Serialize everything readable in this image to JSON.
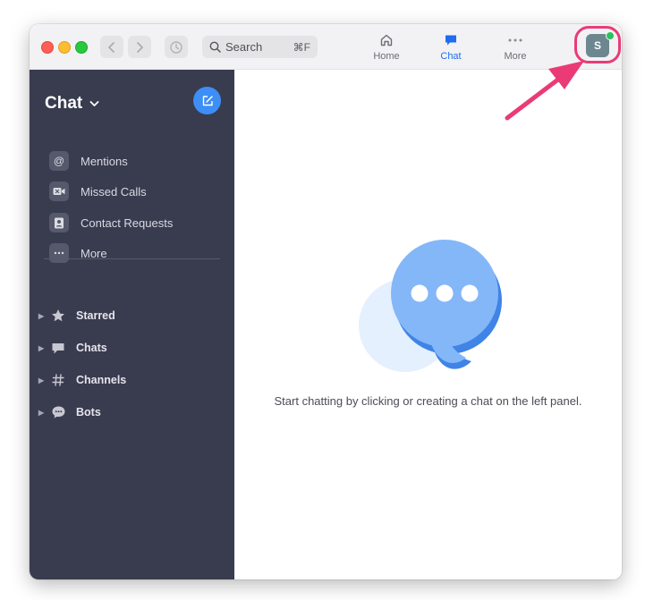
{
  "toolbar": {
    "search_label": "Search",
    "search_shortcut": "⌘F",
    "tabs": [
      {
        "label": "Home",
        "icon": "home-icon",
        "active": false
      },
      {
        "label": "Chat",
        "icon": "chat-bubble-icon",
        "active": true
      },
      {
        "label": "More",
        "icon": "more-dots-icon",
        "active": false
      }
    ],
    "avatar_initial": "S",
    "presence_status": "online",
    "accent_color": "#1f6cf2"
  },
  "sidebar": {
    "title": "Chat",
    "quick_items": [
      {
        "label": "Mentions",
        "icon": "at-icon"
      },
      {
        "label": "Missed Calls",
        "icon": "video-camera-icon"
      },
      {
        "label": "Contact Requests",
        "icon": "contact-card-icon"
      },
      {
        "label": "More",
        "icon": "ellipsis-icon"
      }
    ],
    "sections": [
      {
        "label": "Starred",
        "icon": "star-icon"
      },
      {
        "label": "Chats",
        "icon": "chat-bubble-icon"
      },
      {
        "label": "Channels",
        "icon": "hashtag-icon"
      },
      {
        "label": "Bots",
        "icon": "bot-bubble-icon"
      }
    ],
    "background_color": "#393b4f"
  },
  "main": {
    "empty_message": "Start chatting by clicking or creating a chat on the left panel."
  },
  "annotation": {
    "highlight_color": "#ea3b77"
  }
}
